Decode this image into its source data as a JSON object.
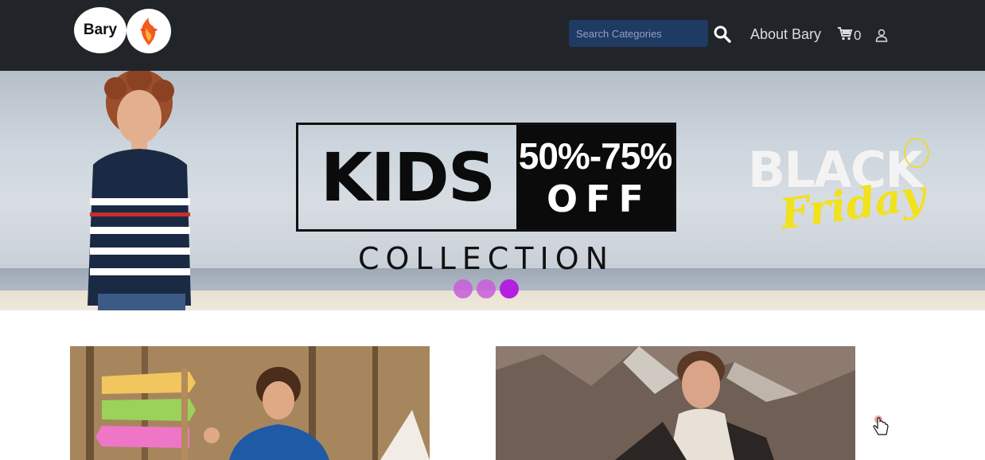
{
  "header": {
    "logo_text": "Bary",
    "search": {
      "placeholder": "Search Categories",
      "value": ""
    },
    "about_label": "About Bary",
    "cart_count": "0"
  },
  "hero": {
    "kids_text": "KIDS",
    "discount_text": "50%-75%",
    "off_text": "OFF",
    "collection_text": "COLLECTION",
    "bf_black": "BLACK",
    "bf_friday": "Friday",
    "carousel_total": 3,
    "carousel_active": 3
  },
  "colors": {
    "header_bg": "#212529",
    "search_bg": "#1f3a63",
    "dot_color": "#c85ddb",
    "dot_active": "#b320e0",
    "friday_yellow": "#f2e11d"
  },
  "icons": {
    "search": "search-icon",
    "cart": "cart-icon",
    "user": "user-icon",
    "logo": "phoenix-logo-icon",
    "cursor": "hand-pointer-icon"
  }
}
